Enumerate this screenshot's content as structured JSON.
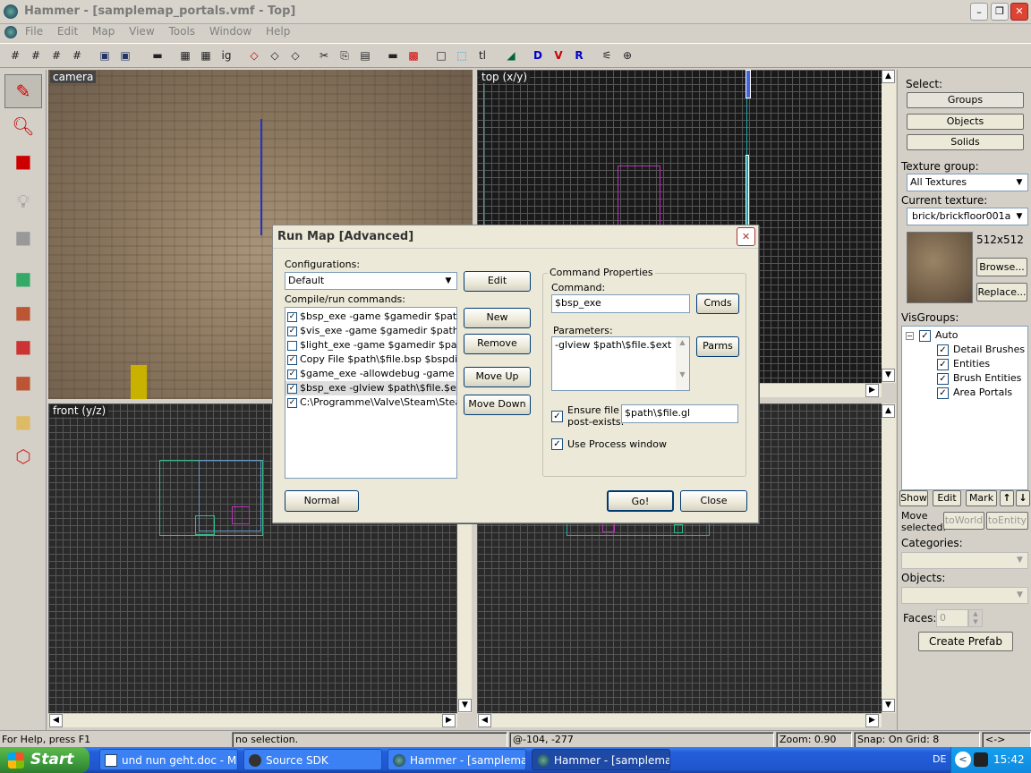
{
  "window": {
    "title": "Hammer - [samplemap_portals.vmf - Top]"
  },
  "menu": [
    "File",
    "Edit",
    "Map",
    "View",
    "Tools",
    "Window",
    "Help"
  ],
  "viewports": {
    "camera": "camera",
    "top": "top (x/y)",
    "front": "front (y/z)"
  },
  "dialog": {
    "title": "Run Map [Advanced]",
    "configurations_label": "Configurations:",
    "configuration_value": "Default",
    "compile_label": "Compile/run commands:",
    "commands": [
      {
        "checked": true,
        "text": "$bsp_exe -game $gamedir $path\\$file"
      },
      {
        "checked": true,
        "text": "$vis_exe -game $gamedir $path\\$file"
      },
      {
        "checked": false,
        "text": "$light_exe -game $gamedir $path\\$file"
      },
      {
        "checked": true,
        "text": "Copy File $path\\$file.bsp $bspdir\\$file"
      },
      {
        "checked": true,
        "text": "$game_exe -allowdebug -game $gam"
      },
      {
        "checked": true,
        "text": "$bsp_exe -glview $path\\$file.$ext"
      },
      {
        "checked": true,
        "text": "C:\\Programme\\Valve\\Steam\\SteamA"
      }
    ],
    "btn_edit": "Edit",
    "btn_new": "New",
    "btn_remove": "Remove",
    "btn_moveup": "Move Up",
    "btn_movedown": "Move Down",
    "command_properties": "Command Properties",
    "command_label": "Command:",
    "command_value": "$bsp_exe",
    "btn_cmds": "Cmds",
    "parameters_label": "Parameters:",
    "parameters_value": "-glview $path\\$file.$ext",
    "btn_parms": "Parms",
    "ensure_label_1": "Ensure file",
    "ensure_label_2": "post-exists:",
    "ensure_value": "$path\\$file.gl",
    "use_process": "Use Process window",
    "btn_normal": "Normal",
    "btn_go": "Go!",
    "btn_close": "Close"
  },
  "right_panel": {
    "select_label": "Select:",
    "groups": "Groups",
    "objects": "Objects",
    "solids": "Solids",
    "texture_group_label": "Texture group:",
    "texture_group_value": "All Textures",
    "current_texture_label": "Current texture:",
    "current_texture_value": "brick/brickfloor001a",
    "texture_size": "512x512",
    "browse": "Browse...",
    "replace": "Replace...",
    "visgroups_label": "VisGroups:",
    "vis_auto": "Auto",
    "vis_items": [
      "Detail Brushes",
      "Entities",
      "Brush Entities",
      "Area Portals"
    ],
    "show": "Show",
    "edit": "Edit",
    "mark": "Mark",
    "move_selected_1": "Move",
    "move_selected_2": "selected:",
    "to_world": "toWorld",
    "to_entity": "toEntity",
    "categories_label": "Categories:",
    "objects_label": "Objects:",
    "faces_label": "Faces:",
    "faces_value": "0",
    "create_prefab": "Create Prefab"
  },
  "status": {
    "help": "For Help, press F1",
    "selection": "no selection.",
    "coords": "@-104, -277",
    "zoom": "Zoom: 0.90",
    "snap": "Snap: On Grid: 8",
    "extra": "<->"
  },
  "taskbar": {
    "start": "Start",
    "items": [
      "und nun geht.doc - M...",
      "Source SDK",
      "Hammer - [samplema...",
      "Hammer - [samplema..."
    ],
    "lang": "DE",
    "clock": "15:42"
  },
  "colors": {
    "title_active": "#0a246a",
    "dialog_title_bg": "#ece9d8",
    "taskbar": "#245edb",
    "start": "#3c9a3c"
  }
}
